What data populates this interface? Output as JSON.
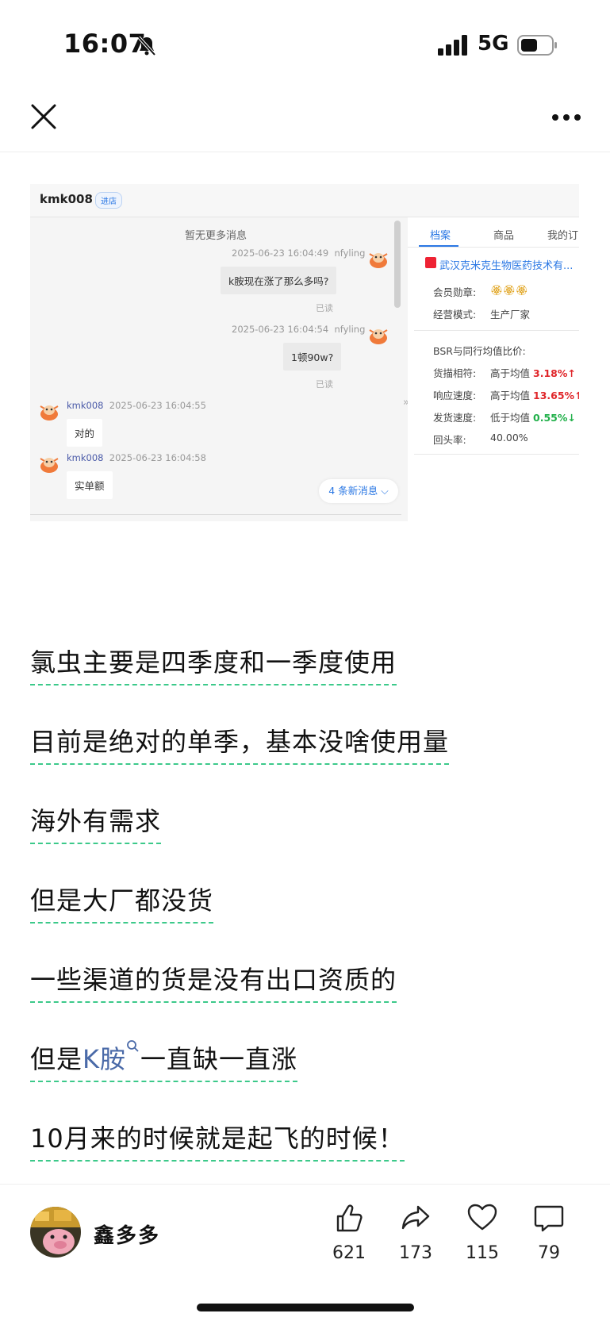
{
  "status_bar": {
    "time": "16:07",
    "network": "5G",
    "icons": [
      "bell-slash-icon",
      "signal-icon",
      "battery-icon"
    ]
  },
  "nav": {
    "close_icon": "close-icon",
    "more_icon": "more-icon"
  },
  "embedded": {
    "username": "kmk008",
    "badge": "进店",
    "no_more": "暂无更多消息",
    "messages": [
      {
        "meta_time": "2025-06-23 16:04:49",
        "sender": "nfyling",
        "text": "k胺现在涨了那么多吗?",
        "status": "已读"
      },
      {
        "meta_time": "2025-06-23 16:04:54",
        "sender": "nfyling",
        "text": "1顿90w?",
        "status": "已读"
      },
      {
        "sender": "kmk008",
        "meta_time": "2025-06-23 16:04:55",
        "text": "对的"
      },
      {
        "sender": "kmk008",
        "meta_time": "2025-06-23 16:04:58",
        "text": "实单额"
      }
    ],
    "new_messages": "4 条新消息",
    "tabs": [
      "档案",
      "商品",
      "我的订"
    ],
    "shop_name": "武汉克米克生物医药技术有...",
    "info": [
      {
        "label": "会员勋章:",
        "value": "🏵🏵🏵"
      },
      {
        "label": "经营模式:",
        "value": "生产厂家"
      }
    ],
    "bsr_title": "BSR与同行均值比价:",
    "bsr": [
      {
        "label": "货描相符:",
        "cmp": "高于均值",
        "pct": "3.18%",
        "arrow": "↑",
        "color": "red"
      },
      {
        "label": "响应速度:",
        "cmp": "高于均值",
        "pct": "13.65%",
        "arrow": "↑",
        "color": "red"
      },
      {
        "label": "发货速度:",
        "cmp": "低于均值",
        "pct": "0.55%",
        "arrow": "↓",
        "color": "green"
      }
    ],
    "return_rate": {
      "label": "回头率:",
      "value": "40.00%"
    }
  },
  "article": {
    "lines": [
      "氯虫主要是四季度和一季度使用",
      "目前是绝对的单季，基本没啥使用量",
      "海外有需求",
      "但是大厂都没货",
      "一些渠道的货是没有出口资质的"
    ],
    "line6_prefix": "但是",
    "line6_link": "K胺",
    "line6_suffix": "一直缺一直涨",
    "line7": "10月来的时候就是起飞的时候！"
  },
  "footer": {
    "author": "鑫多多",
    "like_count": "621",
    "share_count": "173",
    "fav_count": "115",
    "comment_count": "79"
  }
}
